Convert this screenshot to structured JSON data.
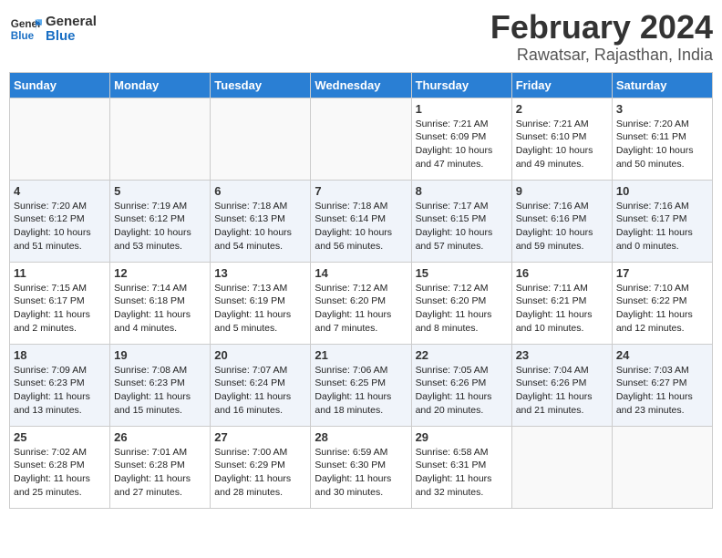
{
  "logo": {
    "line1": "General",
    "line2": "Blue"
  },
  "title": "February 2024",
  "subtitle": "Rawatsar, Rajasthan, India",
  "days_of_week": [
    "Sunday",
    "Monday",
    "Tuesday",
    "Wednesday",
    "Thursday",
    "Friday",
    "Saturday"
  ],
  "weeks": [
    [
      {
        "day": "",
        "info": ""
      },
      {
        "day": "",
        "info": ""
      },
      {
        "day": "",
        "info": ""
      },
      {
        "day": "",
        "info": ""
      },
      {
        "day": "1",
        "info": "Sunrise: 7:21 AM\nSunset: 6:09 PM\nDaylight: 10 hours\nand 47 minutes."
      },
      {
        "day": "2",
        "info": "Sunrise: 7:21 AM\nSunset: 6:10 PM\nDaylight: 10 hours\nand 49 minutes."
      },
      {
        "day": "3",
        "info": "Sunrise: 7:20 AM\nSunset: 6:11 PM\nDaylight: 10 hours\nand 50 minutes."
      }
    ],
    [
      {
        "day": "4",
        "info": "Sunrise: 7:20 AM\nSunset: 6:12 PM\nDaylight: 10 hours\nand 51 minutes."
      },
      {
        "day": "5",
        "info": "Sunrise: 7:19 AM\nSunset: 6:12 PM\nDaylight: 10 hours\nand 53 minutes."
      },
      {
        "day": "6",
        "info": "Sunrise: 7:18 AM\nSunset: 6:13 PM\nDaylight: 10 hours\nand 54 minutes."
      },
      {
        "day": "7",
        "info": "Sunrise: 7:18 AM\nSunset: 6:14 PM\nDaylight: 10 hours\nand 56 minutes."
      },
      {
        "day": "8",
        "info": "Sunrise: 7:17 AM\nSunset: 6:15 PM\nDaylight: 10 hours\nand 57 minutes."
      },
      {
        "day": "9",
        "info": "Sunrise: 7:16 AM\nSunset: 6:16 PM\nDaylight: 10 hours\nand 59 minutes."
      },
      {
        "day": "10",
        "info": "Sunrise: 7:16 AM\nSunset: 6:17 PM\nDaylight: 11 hours\nand 0 minutes."
      }
    ],
    [
      {
        "day": "11",
        "info": "Sunrise: 7:15 AM\nSunset: 6:17 PM\nDaylight: 11 hours\nand 2 minutes."
      },
      {
        "day": "12",
        "info": "Sunrise: 7:14 AM\nSunset: 6:18 PM\nDaylight: 11 hours\nand 4 minutes."
      },
      {
        "day": "13",
        "info": "Sunrise: 7:13 AM\nSunset: 6:19 PM\nDaylight: 11 hours\nand 5 minutes."
      },
      {
        "day": "14",
        "info": "Sunrise: 7:12 AM\nSunset: 6:20 PM\nDaylight: 11 hours\nand 7 minutes."
      },
      {
        "day": "15",
        "info": "Sunrise: 7:12 AM\nSunset: 6:20 PM\nDaylight: 11 hours\nand 8 minutes."
      },
      {
        "day": "16",
        "info": "Sunrise: 7:11 AM\nSunset: 6:21 PM\nDaylight: 11 hours\nand 10 minutes."
      },
      {
        "day": "17",
        "info": "Sunrise: 7:10 AM\nSunset: 6:22 PM\nDaylight: 11 hours\nand 12 minutes."
      }
    ],
    [
      {
        "day": "18",
        "info": "Sunrise: 7:09 AM\nSunset: 6:23 PM\nDaylight: 11 hours\nand 13 minutes."
      },
      {
        "day": "19",
        "info": "Sunrise: 7:08 AM\nSunset: 6:23 PM\nDaylight: 11 hours\nand 15 minutes."
      },
      {
        "day": "20",
        "info": "Sunrise: 7:07 AM\nSunset: 6:24 PM\nDaylight: 11 hours\nand 16 minutes."
      },
      {
        "day": "21",
        "info": "Sunrise: 7:06 AM\nSunset: 6:25 PM\nDaylight: 11 hours\nand 18 minutes."
      },
      {
        "day": "22",
        "info": "Sunrise: 7:05 AM\nSunset: 6:26 PM\nDaylight: 11 hours\nand 20 minutes."
      },
      {
        "day": "23",
        "info": "Sunrise: 7:04 AM\nSunset: 6:26 PM\nDaylight: 11 hours\nand 21 minutes."
      },
      {
        "day": "24",
        "info": "Sunrise: 7:03 AM\nSunset: 6:27 PM\nDaylight: 11 hours\nand 23 minutes."
      }
    ],
    [
      {
        "day": "25",
        "info": "Sunrise: 7:02 AM\nSunset: 6:28 PM\nDaylight: 11 hours\nand 25 minutes."
      },
      {
        "day": "26",
        "info": "Sunrise: 7:01 AM\nSunset: 6:28 PM\nDaylight: 11 hours\nand 27 minutes."
      },
      {
        "day": "27",
        "info": "Sunrise: 7:00 AM\nSunset: 6:29 PM\nDaylight: 11 hours\nand 28 minutes."
      },
      {
        "day": "28",
        "info": "Sunrise: 6:59 AM\nSunset: 6:30 PM\nDaylight: 11 hours\nand 30 minutes."
      },
      {
        "day": "29",
        "info": "Sunrise: 6:58 AM\nSunset: 6:31 PM\nDaylight: 11 hours\nand 32 minutes."
      },
      {
        "day": "",
        "info": ""
      },
      {
        "day": "",
        "info": ""
      }
    ]
  ]
}
